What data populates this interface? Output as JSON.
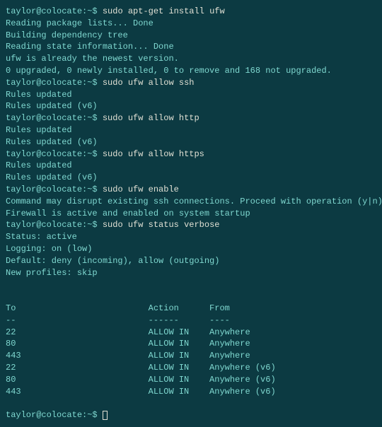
{
  "prompt_user": "taylor@colocate",
  "prompt_sep": ":~$ ",
  "commands": {
    "install": "sudo apt-get install ufw",
    "allow_ssh": "sudo ufw allow ssh",
    "allow_http": "sudo ufw allow http",
    "allow_https": "sudo ufw allow https",
    "enable": "sudo ufw enable",
    "status": "sudo ufw status verbose"
  },
  "output": {
    "install": [
      "Reading package lists... Done",
      "Building dependency tree",
      "Reading state information... Done",
      "ufw is already the newest version.",
      "0 upgraded, 0 newly installed, 0 to remove and 168 not upgraded."
    ],
    "rules_updated": "Rules updated",
    "rules_updated_v6": "Rules updated (v6)",
    "enable_prompt": "Command may disrupt existing ssh connections. Proceed with operation (y|n)? y",
    "enable_result": "Firewall is active and enabled on system startup",
    "status": {
      "active": "Status: active",
      "logging": "Logging: on (low)",
      "default": "Default: deny (incoming), allow (outgoing)",
      "profiles": "New profiles: skip"
    },
    "table": {
      "header": {
        "to": "To",
        "action": "Action",
        "from": "From"
      },
      "divider": {
        "to": "--",
        "action": "------",
        "from": "----"
      },
      "rows": [
        {
          "to": "22",
          "action": "ALLOW IN",
          "from": "Anywhere"
        },
        {
          "to": "80",
          "action": "ALLOW IN",
          "from": "Anywhere"
        },
        {
          "to": "443",
          "action": "ALLOW IN",
          "from": "Anywhere"
        },
        {
          "to": "22",
          "action": "ALLOW IN",
          "from": "Anywhere (v6)"
        },
        {
          "to": "80",
          "action": "ALLOW IN",
          "from": "Anywhere (v6)"
        },
        {
          "to": "443",
          "action": "ALLOW IN",
          "from": "Anywhere (v6)"
        }
      ]
    }
  }
}
